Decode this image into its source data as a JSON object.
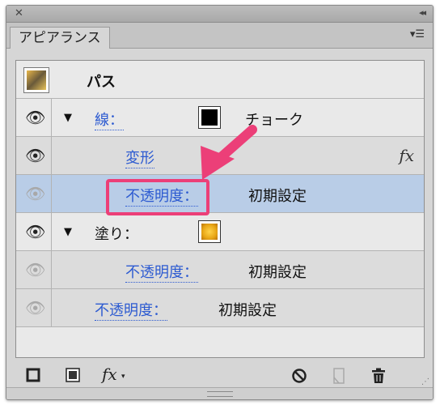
{
  "titlebar": {
    "close_glyph": "✕",
    "collapse_glyph": "◂◂"
  },
  "tab": {
    "label": "アピアランス"
  },
  "panel_menu_glyph": "▾☰",
  "rows": {
    "path": {
      "label": "パス",
      "icon": "path-thumbnail"
    },
    "stroke": {
      "label": "線：",
      "value": "チョーク",
      "swatch_color": "#000000"
    },
    "transform": {
      "label": "変形",
      "fx_glyph": "fx"
    },
    "stroke_opacity": {
      "label": "不透明度：",
      "value": "初期設定"
    },
    "fill": {
      "label": "塗り：",
      "swatch_color": "#e8a616"
    },
    "fill_opacity": {
      "label": "不透明度：",
      "value": "初期設定"
    },
    "object_opacity": {
      "label": "不透明度：",
      "value": "初期設定"
    }
  },
  "bottom_toolbar": {
    "fx_label": "fx"
  },
  "colors": {
    "link": "#2d5bd1",
    "selection": "#b9cde7",
    "callout": "#ec3f78"
  }
}
